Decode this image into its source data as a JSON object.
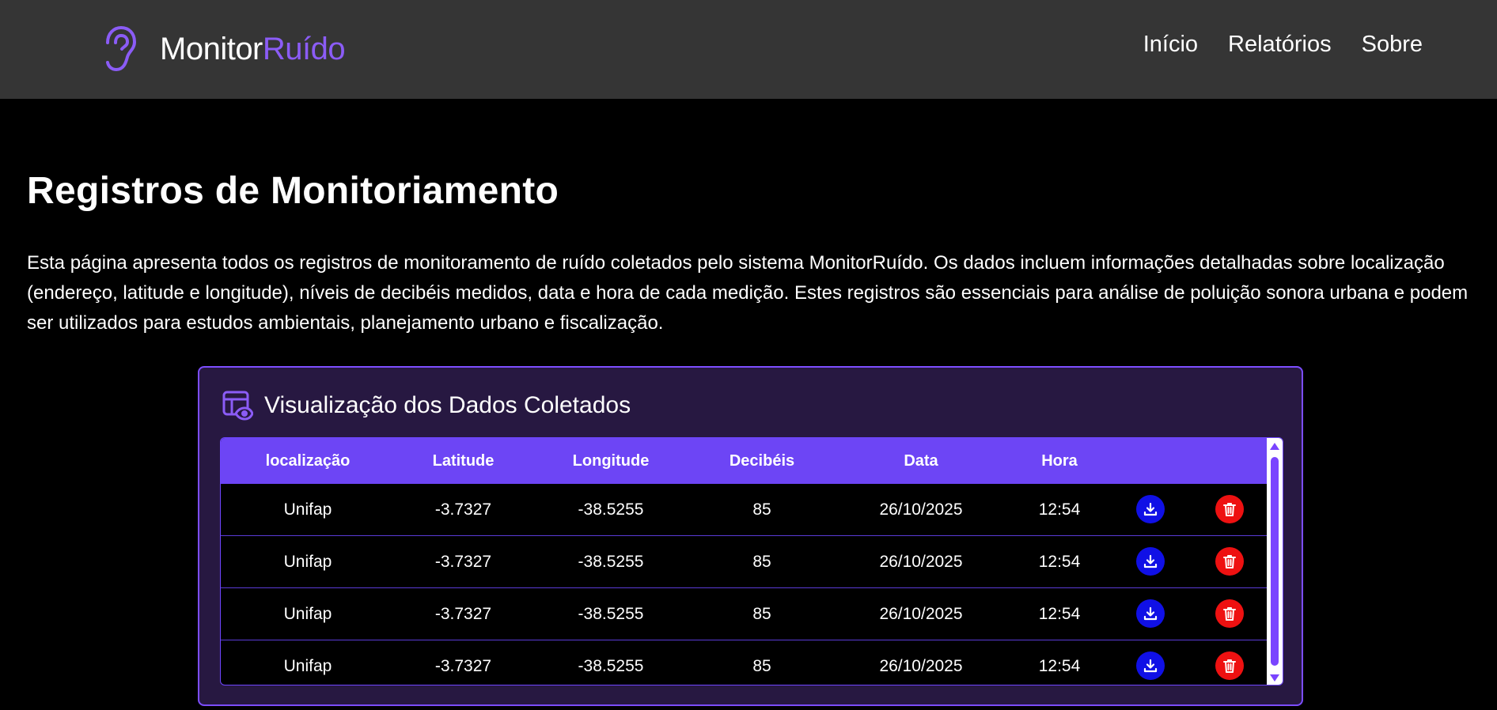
{
  "header": {
    "brand_main": "Monitor",
    "brand_accent": "Ruído",
    "brand_icon": "ear-icon",
    "nav": [
      {
        "label": "Início"
      },
      {
        "label": "Relatórios"
      },
      {
        "label": "Sobre"
      }
    ]
  },
  "main": {
    "title": "Registros de Monitoriamento",
    "intro": "Esta página apresenta todos os registros de monitoramento de ruído coletados pelo sistema MonitorRuído. Os dados incluem informações detalhadas sobre localização (endereço, latitude e longitude), níveis de decibéis medidos, data e hora de cada medição. Estes registros são essenciais para análise de poluição sonora urbana e podem ser utilizados para estudos ambientais, planejamento urbano e fiscalização."
  },
  "card": {
    "title": "Visualização dos Dados Coletados",
    "icon": "table-eye-icon"
  },
  "table": {
    "headers": [
      "localização",
      "Latitude",
      "Longitude",
      "Decibéis",
      "Data",
      "Hora"
    ],
    "rows": [
      {
        "localizacao": "Unifap",
        "latitude": "-3.7327",
        "longitude": "-38.5255",
        "decibeis": "85",
        "data": "26/10/2025",
        "hora": "12:54"
      },
      {
        "localizacao": "Unifap",
        "latitude": "-3.7327",
        "longitude": "-38.5255",
        "decibeis": "85",
        "data": "26/10/2025",
        "hora": "12:54"
      },
      {
        "localizacao": "Unifap",
        "latitude": "-3.7327",
        "longitude": "-38.5255",
        "decibeis": "85",
        "data": "26/10/2025",
        "hora": "12:54"
      },
      {
        "localizacao": "Unifap",
        "latitude": "-3.7327",
        "longitude": "-38.5255",
        "decibeis": "85",
        "data": "26/10/2025",
        "hora": "12:54"
      }
    ],
    "row_actions": {
      "download_icon": "download-icon",
      "delete_icon": "trash-icon"
    }
  },
  "colors": {
    "accent": "#8b5cf6",
    "header_bg": "#353535",
    "table_header_bg": "#6d45f5",
    "card_bg": "#271841",
    "download_btn": "#1010e6",
    "delete_btn": "#ee1111"
  }
}
